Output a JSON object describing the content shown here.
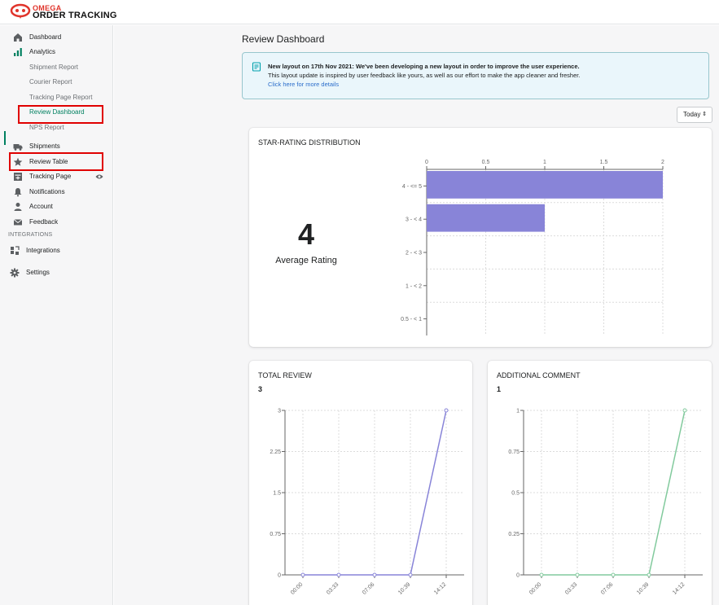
{
  "brand": {
    "line1": "OMEGA",
    "line2": "ORDER TRACKING"
  },
  "sidebar": {
    "dashboard": "Dashboard",
    "analytics": "Analytics",
    "analytics_sub": [
      "Shipment Report",
      "Courier Report",
      "Tracking Page Report",
      "Review Dashboard",
      "NPS Report"
    ],
    "shipments": "Shipments",
    "review_table": "Review Table",
    "tracking_page": "Tracking Page",
    "notifications": "Notifications",
    "account": "Account",
    "feedback": "Feedback",
    "integrations_section": "INTEGRATIONS",
    "integrations": "Integrations",
    "settings": "Settings"
  },
  "page": {
    "title": "Review Dashboard"
  },
  "banner": {
    "headline": "New layout on 17th Nov 2021: We've been developing a new layout in order to improve the user experience.",
    "body": "This layout update is inspired by user feedback like yours, as well as our effort to make the app cleaner and fresher.",
    "link": "Click here for more details"
  },
  "date_filter": {
    "selected": "Today"
  },
  "rating_card": {
    "title": "STAR-RATING DISTRIBUTION",
    "average_value": "4",
    "average_label": "Average Rating"
  },
  "total_card": {
    "title": "TOTAL REVIEW",
    "count": "3"
  },
  "comment_card": {
    "title": "ADDITIONAL COMMENT",
    "count": "1"
  },
  "colors": {
    "accent": "#008060",
    "bar": "#8884d8",
    "purple_line": "#8884d8",
    "green_line": "#82ca9d",
    "highlight": "#e00000"
  },
  "chart_data": [
    {
      "type": "bar",
      "orientation": "horizontal",
      "categories": [
        "4 - <= 5",
        "3 - < 4",
        "2 - < 3",
        "1 - < 2",
        "0.5 - < 1"
      ],
      "values": [
        2,
        1,
        0,
        0,
        0
      ],
      "xlim": [
        0,
        2
      ],
      "xticks": [
        "0",
        "0.5",
        "1",
        "1.5",
        "2"
      ],
      "grid": true
    },
    {
      "type": "line",
      "x": [
        "00:00",
        "03:33",
        "07:06",
        "10:39",
        "14:12"
      ],
      "values": [
        0,
        0,
        0,
        0,
        3
      ],
      "ylim": [
        0,
        3
      ],
      "yticks": [
        "0",
        "0.75",
        "1.5",
        "2.25",
        "3"
      ],
      "color": "#8884d8",
      "grid": true
    },
    {
      "type": "line",
      "x": [
        "00:00",
        "03:33",
        "07:06",
        "10:39",
        "14:12"
      ],
      "values": [
        0,
        0,
        0,
        0,
        1
      ],
      "ylim": [
        0,
        1
      ],
      "yticks": [
        "0",
        "0.25",
        "0.5",
        "0.75",
        "1"
      ],
      "color": "#82ca9d",
      "grid": true
    }
  ]
}
